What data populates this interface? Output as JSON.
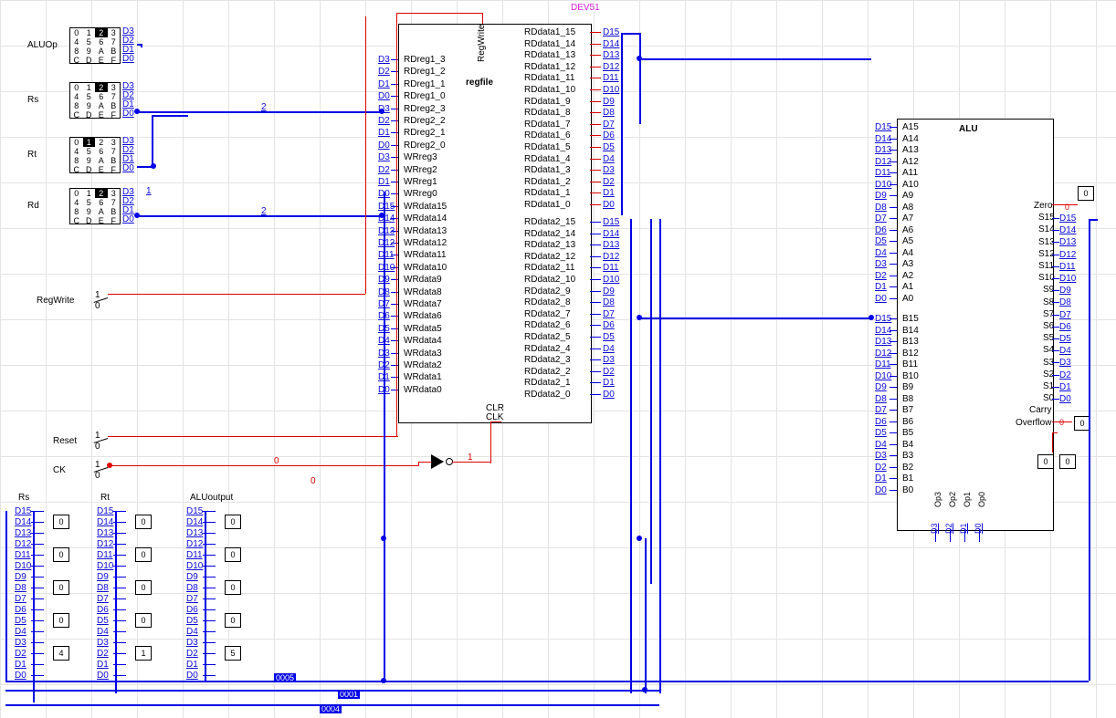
{
  "dev_label": "DEV51",
  "inputs": {
    "ALUOp": {
      "label": "ALUOp",
      "pins": [
        "D3",
        "D2",
        "D1",
        "D0"
      ],
      "key_active": "2"
    },
    "Rs": {
      "label": "Rs",
      "pins": [
        "D3",
        "D2",
        "D1",
        "D0"
      ],
      "key_active": "2"
    },
    "Rt": {
      "label": "Rt",
      "pins": [
        "D3",
        "D2",
        "D1",
        "D0"
      ],
      "key_active": "1"
    },
    "Rd": {
      "label": "Rd",
      "pins": [
        "D3",
        "D2",
        "D1",
        "D0"
      ],
      "key_active": "2"
    },
    "RegWrite": {
      "label": "RegWrite",
      "hi": "1",
      "lo": "0"
    },
    "Reset": {
      "label": "Reset",
      "hi": "1",
      "lo": "0"
    },
    "CK": {
      "label": "CK",
      "hi": "1",
      "lo": "0"
    }
  },
  "keypad_layout": [
    "0",
    "1",
    "2",
    "3",
    "4",
    "5",
    "6",
    "7",
    "8",
    "9",
    "A",
    "B",
    "C",
    "D",
    "E",
    "F"
  ],
  "regfile": {
    "name": "regfile",
    "regwrite": "RegWrite",
    "clr": "CLR",
    "clk": "CLK",
    "left_pins": [
      "D3",
      "D2",
      "D1",
      "D0",
      "D3",
      "D2",
      "D1",
      "D0",
      "D3",
      "D2",
      "D1",
      "D0",
      "D15",
      "D14",
      "D13",
      "D12",
      "D11",
      "D10",
      "D9",
      "D8",
      "D7",
      "D6",
      "D5",
      "D4",
      "D3",
      "D2",
      "D1",
      "D0"
    ],
    "left_labels": [
      "RDreg1_3",
      "RDreg1_2",
      "RDreg1_1",
      "RDreg1_0",
      "RDreg2_3",
      "RDreg2_2",
      "RDreg2_1",
      "RDreg2_0",
      "WRreg3",
      "WRreg2",
      "WRreg1",
      "WRreg0",
      "WRdata15",
      "WRdata14",
      "WRdata13",
      "WRdata12",
      "WRdata11",
      "WRdata10",
      "WRdata9",
      "WRdata8",
      "WRdata7",
      "WRdata6",
      "WRdata5",
      "WRdata4",
      "WRdata3",
      "WRdata2",
      "WRdata1",
      "WRdata0"
    ],
    "right_labels1": [
      "RDdata1_15",
      "RDdata1_14",
      "RDdata1_13",
      "RDdata1_12",
      "RDdata1_11",
      "RDdata1_10",
      "RDdata1_9",
      "RDdata1_8",
      "RDdata1_7",
      "RDdata1_6",
      "RDdata1_5",
      "RDdata1_4",
      "RDdata1_3",
      "RDdata1_2",
      "RDdata1_1",
      "RDdata1_0"
    ],
    "right_labels2": [
      "RDdata2_15",
      "RDdata2_14",
      "RDdata2_13",
      "RDdata2_12",
      "RDdata2_11",
      "RDdata2_10",
      "RDdata2_9",
      "RDdata2_8",
      "RDdata2_7",
      "RDdata2_6",
      "RDdata2_5",
      "RDdata2_4",
      "RDdata2_3",
      "RDdata2_2",
      "RDdata2_1",
      "RDdata2_0"
    ],
    "right_pins": [
      "D15",
      "D14",
      "D13",
      "D12",
      "D11",
      "D10",
      "D9",
      "D8",
      "D7",
      "D6",
      "D5",
      "D4",
      "D3",
      "D2",
      "D1",
      "D0"
    ]
  },
  "alu": {
    "name": "ALU",
    "a_pins": [
      "D15",
      "D14",
      "D13",
      "D12",
      "D11",
      "D10",
      "D9",
      "D8",
      "D7",
      "D6",
      "D5",
      "D4",
      "D3",
      "D2",
      "D1",
      "D0"
    ],
    "a_labels": [
      "A15",
      "A14",
      "A13",
      "A12",
      "A11",
      "A10",
      "A9",
      "A8",
      "A7",
      "A6",
      "A5",
      "A4",
      "A3",
      "A2",
      "A1",
      "A0"
    ],
    "b_labels": [
      "B15",
      "B14",
      "B13",
      "B12",
      "B11",
      "B10",
      "B9",
      "B8",
      "B7",
      "B6",
      "B5",
      "B4",
      "B3",
      "B2",
      "B1",
      "B0"
    ],
    "s_labels": [
      "Zero",
      "S15",
      "S14",
      "S13",
      "S12",
      "S11",
      "S10",
      "S9",
      "S8",
      "S7",
      "S6",
      "S5",
      "S4",
      "S3",
      "S2",
      "S1",
      "S0",
      "Carry",
      "Overflow"
    ],
    "s_pins": [
      "D15",
      "D14",
      "D13",
      "D12",
      "D11",
      "D10",
      "D9",
      "D8",
      "D7",
      "D6",
      "D5",
      "D4",
      "D3",
      "D2",
      "D1",
      "D0"
    ],
    "op_labels": [
      "Op3",
      "Op2",
      "Op1",
      "Op0"
    ],
    "op_pins": [
      "D3",
      "D2",
      "D1",
      "D0"
    ]
  },
  "flag_values": {
    "zero": "0",
    "carry": "0",
    "overflow1": "0",
    "overflow2": "0",
    "zero_wire": "0"
  },
  "displays": {
    "Rs": {
      "label": "Rs",
      "values": [
        "0",
        "0",
        "0",
        "0",
        "4"
      ]
    },
    "Rt": {
      "label": "Rt",
      "values": [
        "0",
        "0",
        "0",
        "0",
        "1"
      ]
    },
    "ALUoutput": {
      "label": "ALUoutput",
      "values": [
        "0",
        "0",
        "0",
        "0",
        "5"
      ]
    }
  },
  "disp_pins": [
    "D15",
    "D14",
    "D13",
    "D12",
    "D11",
    "D10",
    "D9",
    "D8",
    "D7",
    "D6",
    "D5",
    "D4",
    "D3",
    "D2",
    "D1",
    "D0"
  ],
  "wire_tags": {
    "rs": "2",
    "rd": "2",
    "rt_node": "1",
    "ck0": "0",
    "ck1": "1",
    "ck2": "0"
  },
  "bus_tags": {
    "b0005": "0005",
    "b0001": "0001",
    "b0004": "0004"
  }
}
